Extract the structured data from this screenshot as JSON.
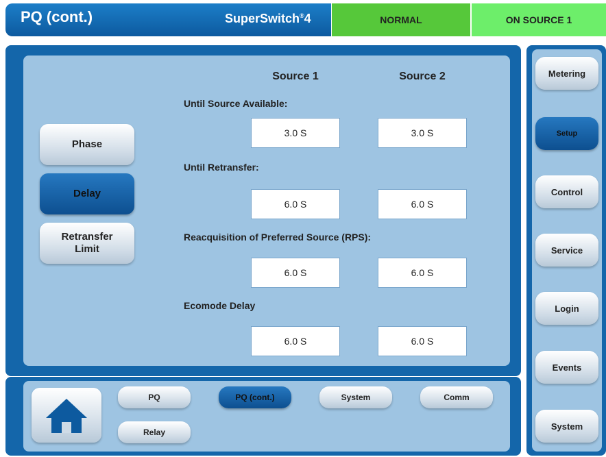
{
  "header": {
    "title": "PQ (cont.)",
    "brand": "SuperSwitch",
    "brand_sup": "®",
    "brand_suffix": "4",
    "status": "NORMAL",
    "source_status": "ON SOURCE 1"
  },
  "columns": {
    "source1": "Source 1",
    "source2": "Source 2"
  },
  "left_tabs": {
    "phase": "Phase",
    "delay": "Delay",
    "retransfer_line1": "Retransfer",
    "retransfer_line2": "Limit"
  },
  "sections": {
    "source_available": {
      "label": "Until Source Available:",
      "s1": "3.0 S",
      "s2": "3.0 S"
    },
    "retransfer": {
      "label": "Until Retransfer:",
      "s1": "6.0 S",
      "s2": "6.0 S"
    },
    "rps": {
      "label": "Reacquisition of Preferred Source (RPS):",
      "s1": "6.0 S",
      "s2": "6.0 S"
    },
    "ecomode": {
      "label": "Ecomode Delay",
      "s1": "6.0 S",
      "s2": "6.0 S"
    }
  },
  "bottom_nav": {
    "pq": "PQ",
    "pq_cont": "PQ (cont.)",
    "system": "System",
    "comm": "Comm",
    "relay": "Relay",
    "home_icon": "home-icon"
  },
  "right_menu": {
    "metering": "Metering",
    "setup": "Setup",
    "control": "Control",
    "service": "Service",
    "login": "Login",
    "events": "Events",
    "system": "System"
  },
  "colors": {
    "frame": "#1466aa",
    "panel": "#9ec4e2",
    "normal": "#56c83a",
    "on_source": "#6dee6a",
    "active_button": "#0d4f90"
  }
}
